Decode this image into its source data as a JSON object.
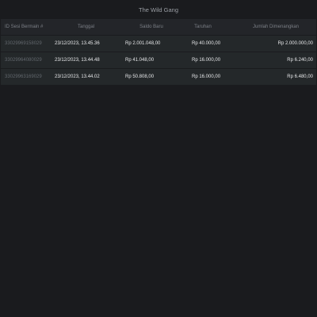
{
  "header": {
    "title": "The Wild Gang"
  },
  "table": {
    "columns": {
      "id": "ID Sesi Bermain #",
      "date": "Tanggal",
      "balance": "Saldo Baru",
      "bet": "Taruhan",
      "win": "Jumlah Dimenangkan"
    },
    "rows": [
      {
        "id": "33029969158029",
        "date": "23/12/2023, 13.45.36",
        "balance": "Rp 2.001.048,00",
        "bet": "Rp 40.000,00",
        "win": "Rp 2.000.000,00"
      },
      {
        "id": "33029964080029",
        "date": "23/12/2023, 13.44.48",
        "balance": "Rp 41.048,00",
        "bet": "Rp 16.000,00",
        "win": "Rp 6.240,00"
      },
      {
        "id": "33029963169029",
        "date": "23/12/2023, 13.44.02",
        "balance": "Rp 50.808,00",
        "bet": "Rp 16.000,00",
        "win": "Rp 6.480,00"
      }
    ]
  }
}
